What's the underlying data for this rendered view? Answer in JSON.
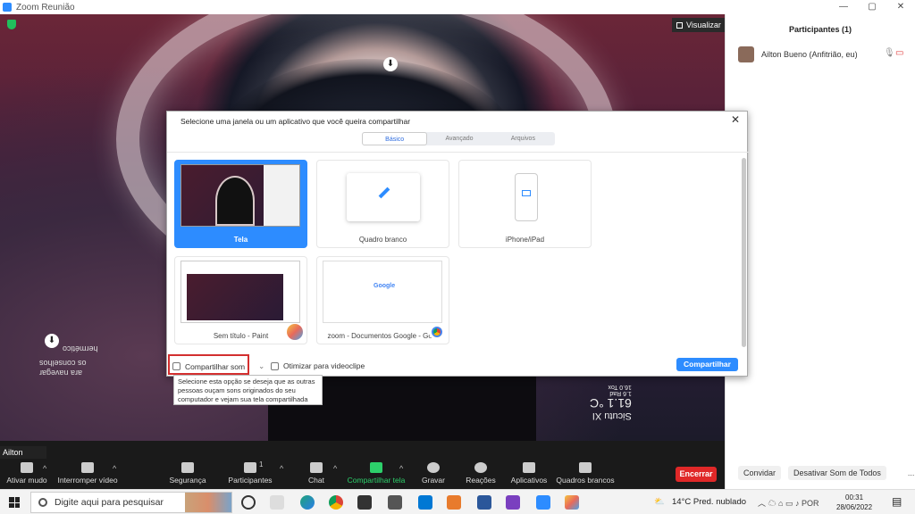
{
  "window": {
    "title": "Zoom Reunião"
  },
  "video": {
    "view_label": "Visualizar",
    "name_tag": "Ailton Bueno",
    "overlay_lines": [
      "hermético",
      "os conselhos",
      "ara navegar"
    ],
    "weather_overlay": {
      "line1": "Sicutu XI",
      "line2": "61.1 °C",
      "line3": "1.6 Rad",
      "line4": "16.0 Tox"
    }
  },
  "participants": {
    "title": "Participantes (1)",
    "list": [
      {
        "name": "Ailton Bueno (Anfitrião, eu)"
      }
    ],
    "footer": {
      "invite": "Convidar",
      "mute_all": "Desativar Som de Todos",
      "more": "..."
    }
  },
  "dialog": {
    "title": "Selecione uma janela ou um aplicativo que você queira compartilhar",
    "tabs": [
      {
        "label": "Básico",
        "active": true
      },
      {
        "label": "Avançado"
      },
      {
        "label": "Arquivos"
      }
    ],
    "tiles": [
      {
        "label": "Tela",
        "selected": true
      },
      {
        "label": "Quadro branco"
      },
      {
        "label": "iPhone/iPad"
      },
      {
        "label": "Sem título - Paint"
      },
      {
        "label": "zoom - Documentos Google - Go..."
      }
    ],
    "share_sound": "Compartilhar som",
    "optimize_video": "Otimizar para videoclipe",
    "share_button": "Compartilhar",
    "tooltip": "Selecione esta opção se deseja que as outras pessoas ouçam sons originados do seu computador e vejam sua tela compartilhada",
    "google_logo": "Google"
  },
  "toolbar": {
    "items": [
      {
        "label": "Ativar mudo"
      },
      {
        "label": "Interromper vídeo"
      },
      {
        "label": "Segurança"
      },
      {
        "label": "Participantes",
        "count": "1"
      },
      {
        "label": "Chat"
      },
      {
        "label": "Compartilhar tela"
      },
      {
        "label": "Gravar"
      },
      {
        "label": "Reações"
      },
      {
        "label": "Aplicativos"
      },
      {
        "label": "Quadros brancos"
      }
    ],
    "end": "Encerrar"
  },
  "taskbar": {
    "search_placeholder": "Digite aqui para pesquisar",
    "weather": "14°C  Pred. nublado",
    "time": "00:31",
    "date": "28/06/2022"
  },
  "colors": {
    "accent": "#2d8cff",
    "end": "#e02828",
    "share_green": "#2dd06b",
    "highlight": "#d32f2f"
  }
}
